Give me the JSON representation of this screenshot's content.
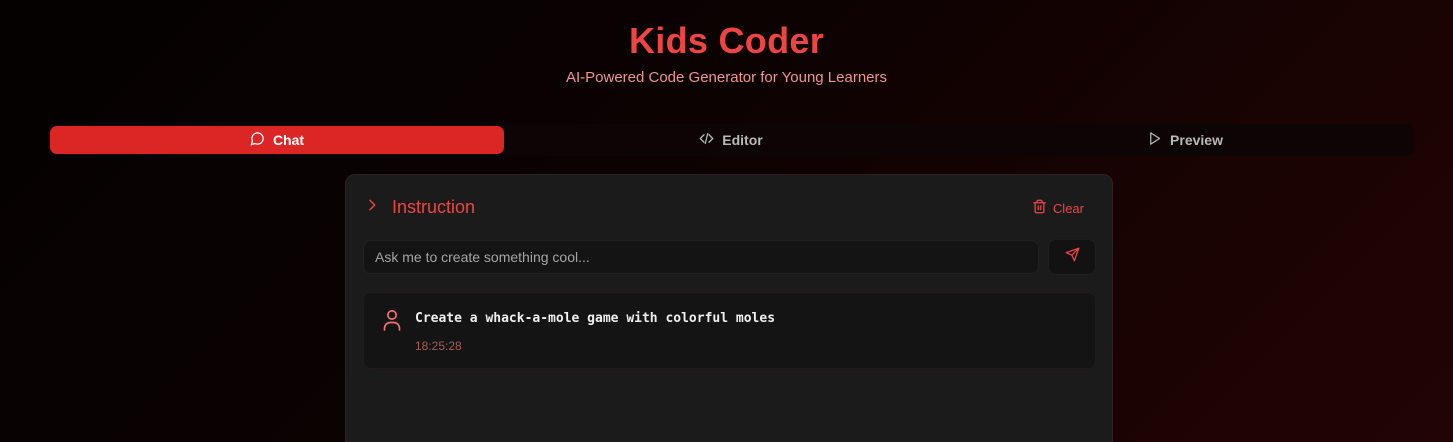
{
  "header": {
    "title": "Kids Coder",
    "subtitle": "AI-Powered Code Generator for Young Learners"
  },
  "tabs": [
    {
      "label": "Chat",
      "icon": "chat-bubble-icon",
      "active": true
    },
    {
      "label": "Editor",
      "icon": "code-icon",
      "active": false
    },
    {
      "label": "Preview",
      "icon": "play-icon",
      "active": false
    }
  ],
  "panel": {
    "title": "Instruction",
    "title_icon": "chevron-right-icon",
    "clear_label": "Clear",
    "clear_icon": "trash-icon",
    "input": {
      "placeholder": "Ask me to create something cool...",
      "value": ""
    },
    "send_icon": "send-icon"
  },
  "messages": [
    {
      "role": "user",
      "avatar_icon": "user-icon",
      "text": "Create a whack-a-mole game with colorful moles",
      "time": "18:25:28"
    }
  ],
  "colors": {
    "accent": "#ef4444",
    "active_tab": "#dc2626",
    "subtitle": "#f0958f",
    "panel_bg": "#1b1b1b",
    "timestamp": "#a55a55"
  }
}
